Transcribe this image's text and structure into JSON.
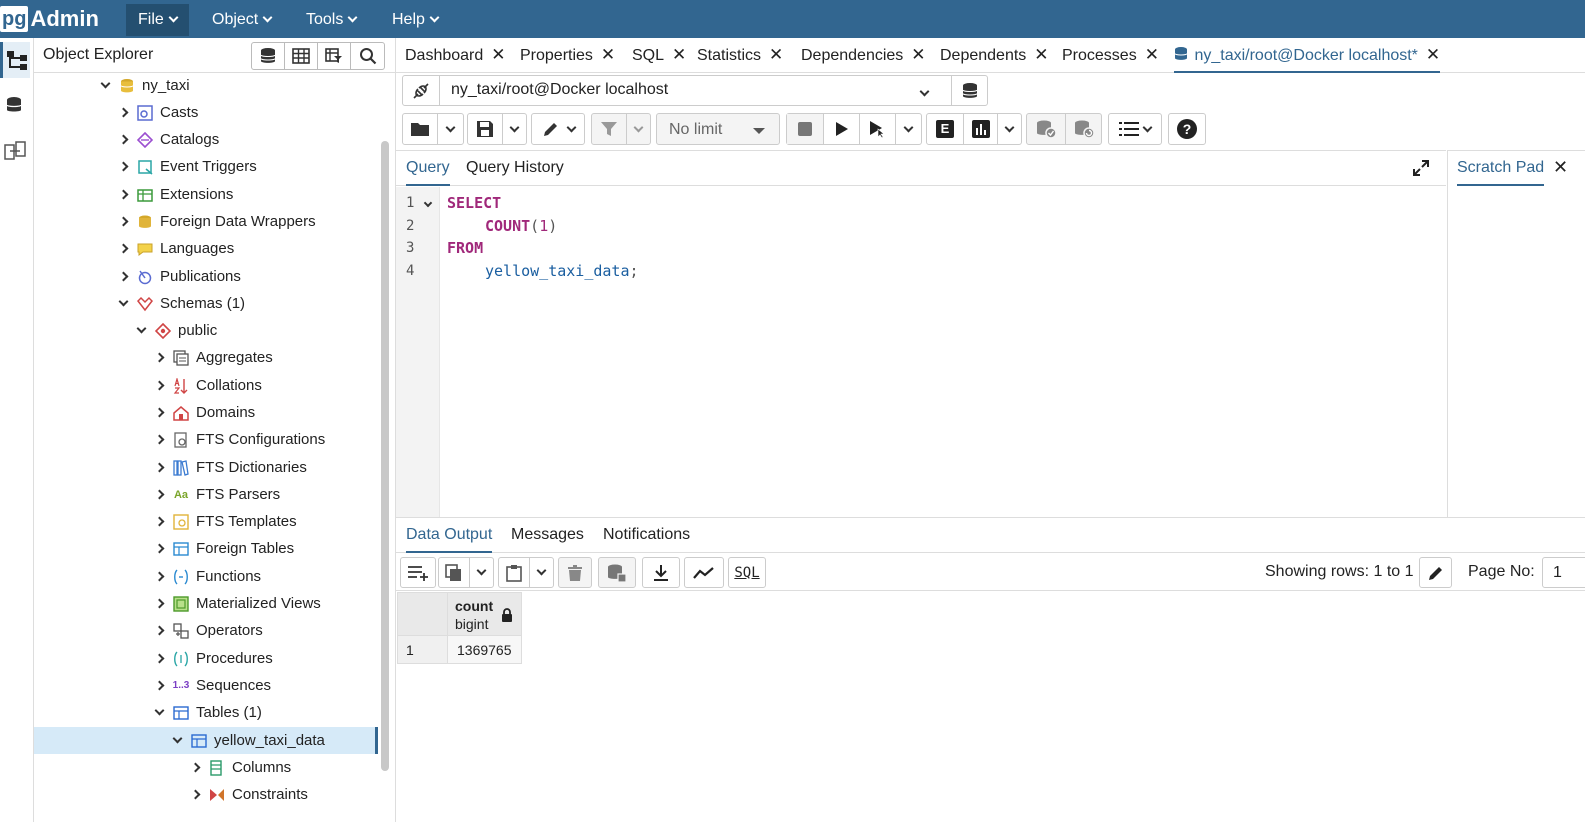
{
  "app": {
    "logo_pg": "pg",
    "logo_admin": "Admin"
  },
  "menu": [
    {
      "label": "File"
    },
    {
      "label": "Object"
    },
    {
      "label": "Tools"
    },
    {
      "label": "Help"
    }
  ],
  "explorer": {
    "title": "Object Explorer",
    "tree": [
      {
        "label": "ny_taxi",
        "icon": "database-icon"
      },
      {
        "label": "Casts",
        "icon": "casts-icon"
      },
      {
        "label": "Catalogs",
        "icon": "catalogs-icon"
      },
      {
        "label": "Event Triggers",
        "icon": "event-triggers-icon"
      },
      {
        "label": "Extensions",
        "icon": "extensions-icon"
      },
      {
        "label": "Foreign Data Wrappers",
        "icon": "foreign-data-wrappers-icon"
      },
      {
        "label": "Languages",
        "icon": "languages-icon"
      },
      {
        "label": "Publications",
        "icon": "publications-icon"
      },
      {
        "label": "Schemas",
        "count": "(1)",
        "icon": "schemas-icon"
      },
      {
        "label": "public",
        "icon": "schema-icon"
      },
      {
        "label": "Aggregates",
        "icon": "aggregates-icon"
      },
      {
        "label": "Collations",
        "icon": "collations-icon"
      },
      {
        "label": "Domains",
        "icon": "domains-icon"
      },
      {
        "label": "FTS Configurations",
        "icon": "fts-configurations-icon"
      },
      {
        "label": "FTS Dictionaries",
        "icon": "fts-dictionaries-icon"
      },
      {
        "label": "FTS Parsers",
        "icon": "fts-parsers-icon"
      },
      {
        "label": "FTS Templates",
        "icon": "fts-templates-icon"
      },
      {
        "label": "Foreign Tables",
        "icon": "foreign-tables-icon"
      },
      {
        "label": "Functions",
        "icon": "functions-icon"
      },
      {
        "label": "Materialized Views",
        "icon": "materialized-views-icon"
      },
      {
        "label": "Operators",
        "icon": "operators-icon"
      },
      {
        "label": "Procedures",
        "icon": "procedures-icon"
      },
      {
        "label": "Sequences",
        "icon": "sequences-icon"
      },
      {
        "label": "Tables",
        "count": "(1)",
        "icon": "tables-icon"
      },
      {
        "label": "yellow_taxi_data",
        "icon": "table-icon"
      },
      {
        "label": "Columns",
        "icon": "columns-icon"
      },
      {
        "label": "Constraints",
        "icon": "constraints-icon"
      }
    ],
    "aa_glyph": "Aa",
    "seq_glyph": "1..3"
  },
  "tabs": [
    {
      "label": "Dashboard"
    },
    {
      "label": "Properties"
    },
    {
      "label": "SQL"
    },
    {
      "label": "Statistics"
    },
    {
      "label": "Dependencies"
    },
    {
      "label": "Dependents"
    },
    {
      "label": "Processes"
    },
    {
      "label": "ny_taxi/root@Docker localhost*"
    }
  ],
  "connection": {
    "value": "ny_taxi/root@Docker localhost"
  },
  "toolbar": {
    "limit_value": "No limit",
    "explain_glyph": "E",
    "help_glyph": "?"
  },
  "query_tabs": [
    {
      "label": "Query"
    },
    {
      "label": "Query History"
    }
  ],
  "scratch_pad": {
    "label": "Scratch Pad"
  },
  "editor": {
    "line_numbers": [
      "1",
      "2",
      "3",
      "4"
    ],
    "select_kw": "SELECT",
    "count_fn": "COUNT",
    "open_paren": "(",
    "count_arg": "1",
    "close_paren": ")",
    "from_kw": "FROM",
    "table_name": "yellow_taxi_data",
    "semicolon": ";"
  },
  "output_tabs": [
    {
      "label": "Data Output"
    },
    {
      "label": "Messages"
    },
    {
      "label": "Notifications"
    }
  ],
  "output": {
    "rows_info": "Showing rows: 1 to 1",
    "page_label": "Page No:",
    "page_value": "1",
    "sql_btn": "SQL",
    "columns": [
      {
        "name": "count",
        "type": "bigint"
      }
    ],
    "rows": [
      {
        "num": "1",
        "values": [
          "1369765"
        ]
      }
    ]
  },
  "colors": {
    "brand": "#326690",
    "selected_row": "#d6eaf8"
  }
}
